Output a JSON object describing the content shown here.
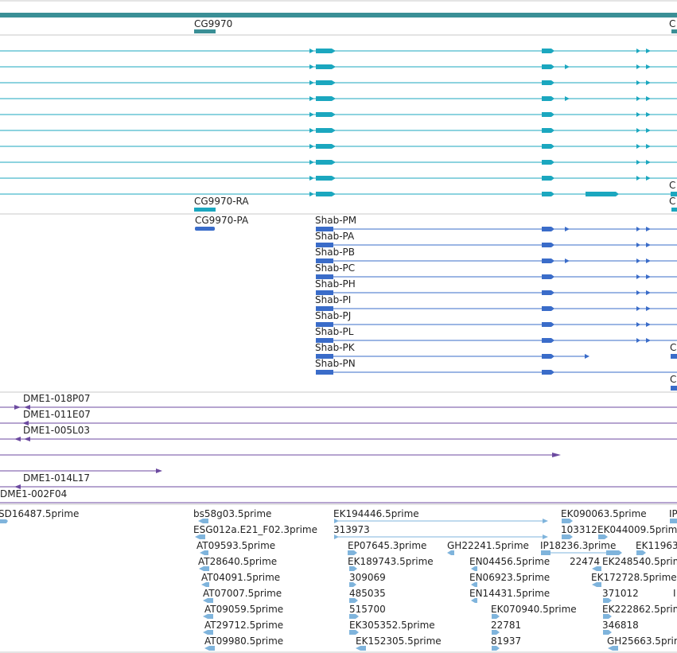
{
  "colors": {
    "summary": "#3a8f96",
    "transcripts": "#1ba7bf",
    "proteins": "#3a6cc9",
    "clones": "#6c4aa0",
    "ests": "#7fb4dc",
    "label": "#222222",
    "separator": "#c9c9c9"
  },
  "tracks": {
    "gene_summary": {
      "labels": [
        "CG9970",
        "C"
      ]
    },
    "transcripts": {
      "labels": [
        "CG9970-RA",
        "C",
        "C"
      ]
    },
    "proteins": {
      "labels": [
        "CG9970-PA",
        "Shab-PM",
        "Shab-PA",
        "Shab-PB",
        "Shab-PC",
        "Shab-PH",
        "Shab-PI",
        "Shab-PJ",
        "Shab-PL",
        "Shab-PK",
        "Shab-PN",
        "C",
        "C"
      ]
    },
    "clones": {
      "labels": [
        "DME1-018P07",
        "DME1-011E07",
        "DME1-005L03",
        "DME1-014L17",
        "DME1-002F04"
      ]
    },
    "ests": {
      "labels": [
        "SD16487.5prime",
        "bs58g03.5prime",
        "EK194446.5prime",
        "EK090063.5prime",
        "IP",
        "ESG012a.E21_F02.3prime",
        "313973",
        "103312",
        "EK044009.5prime",
        "AT09593.5prime",
        "EP07645.3prime",
        "GH22241.5prime",
        "IP18236.3prime",
        "EK11963",
        "AT28640.5prime",
        "EK189743.5prime",
        "EN04456.5prime",
        "22474",
        "EK248540.5prime",
        "AT04091.5prime",
        "309069",
        "EN06923.5prime",
        "EK172728.5prime",
        "AT07007.5prime",
        "485035",
        "EN14431.5prime",
        "371012",
        "I",
        "AT09059.5prime",
        "515700",
        "EK070940.5prime",
        "EK222862.5prime",
        "AT29712.5prime",
        "EK305352.5prime",
        "22781",
        "346818",
        "AT09980.5prime",
        "EK152305.5prime",
        "81937",
        "GH25663.5prime"
      ]
    }
  }
}
